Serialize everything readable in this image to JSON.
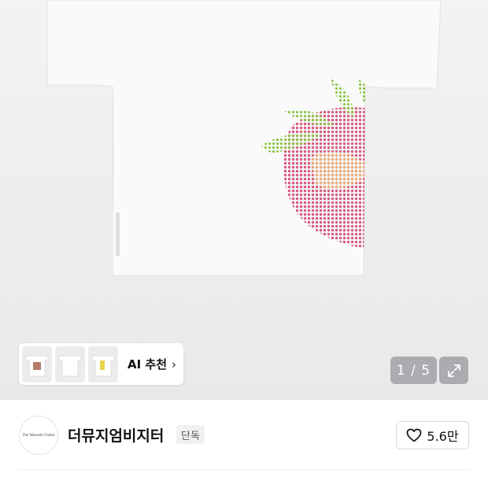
{
  "gallery": {
    "ai_recommend_label": "AI 추천",
    "page_indicator": "1 / 5",
    "thumbnails": [
      "shirt-strawberry-thumb",
      "shirt-plain-thumb",
      "shirt-yellow-thumb"
    ]
  },
  "brand": {
    "logo_text": "The Museum Visitor",
    "name": "더뮤지엄비지터",
    "exclusive_badge": "단독",
    "like_count": "5.6만"
  },
  "colors": {
    "strawberry": "#d9587a",
    "leaf": "#8ac24a",
    "overlay": "#7d7d84"
  }
}
